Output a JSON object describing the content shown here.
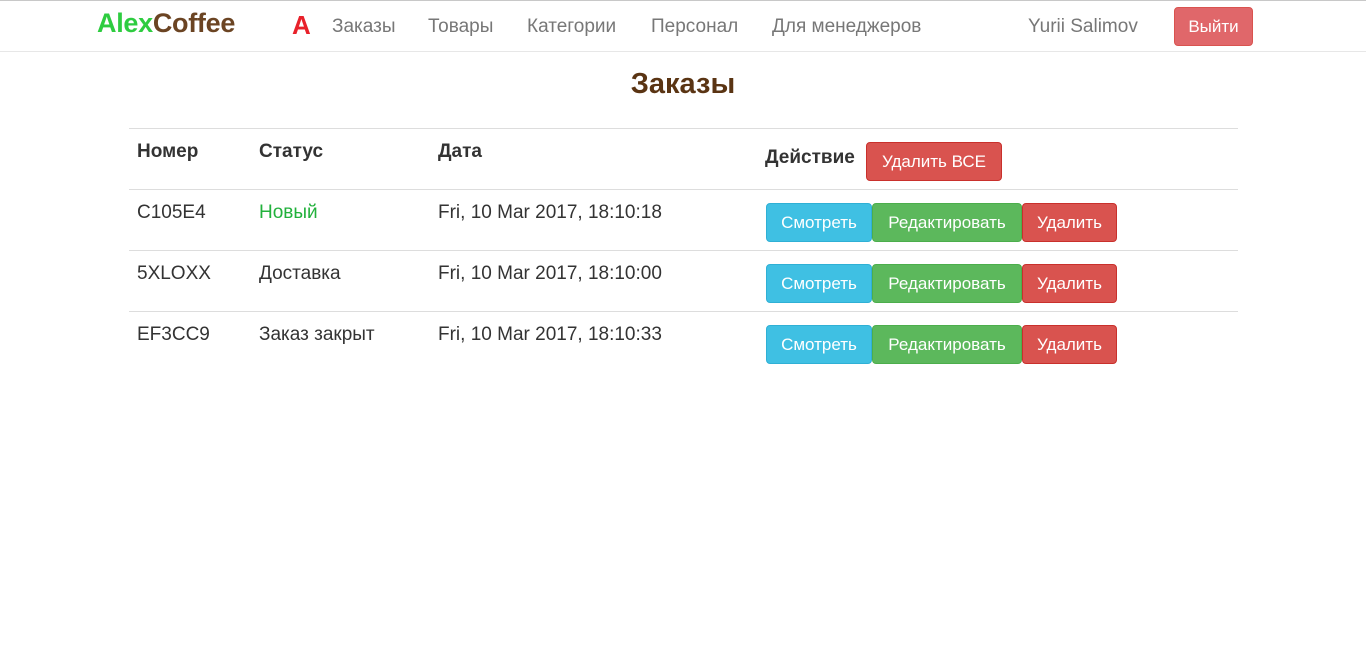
{
  "navbar": {
    "brand_part1": "Alex",
    "brand_part2": "Coffee",
    "brand_mark": "A",
    "links": [
      "Заказы",
      "Товары",
      "Категории",
      "Персонал",
      "Для менеджеров"
    ],
    "user": "Yurii Salimov",
    "logout": "Выйти"
  },
  "page": {
    "title": "Заказы"
  },
  "table": {
    "headers": {
      "number": "Номер",
      "status": "Статус",
      "date": "Дата",
      "action": "Действие"
    },
    "delete_all": "Удалить ВСЕ",
    "buttons": {
      "view": "Смотреть",
      "edit": "Редактировать",
      "delete": "Удалить"
    },
    "rows": [
      {
        "number": "C105E4",
        "status": "Новый",
        "date": "Fri, 10 Mar 2017, 18:10:18"
      },
      {
        "number": "5XLOXX",
        "status": "Доставка",
        "date": "Fri, 10 Mar 2017, 18:10:00"
      },
      {
        "number": "EF3CC9",
        "status": "Заказ закрыт",
        "date": "Fri, 10 Mar 2017, 18:10:33"
      }
    ]
  },
  "colors": {
    "brand_green": "#2ecc40",
    "brand_brown": "#6b4423",
    "brand_mark_red": "#e8212a",
    "title_brown": "#5a3413",
    "status_new_green": "#22b13c",
    "info": "#3fc0e3",
    "success": "#5cb85c",
    "danger": "#d9534f"
  }
}
